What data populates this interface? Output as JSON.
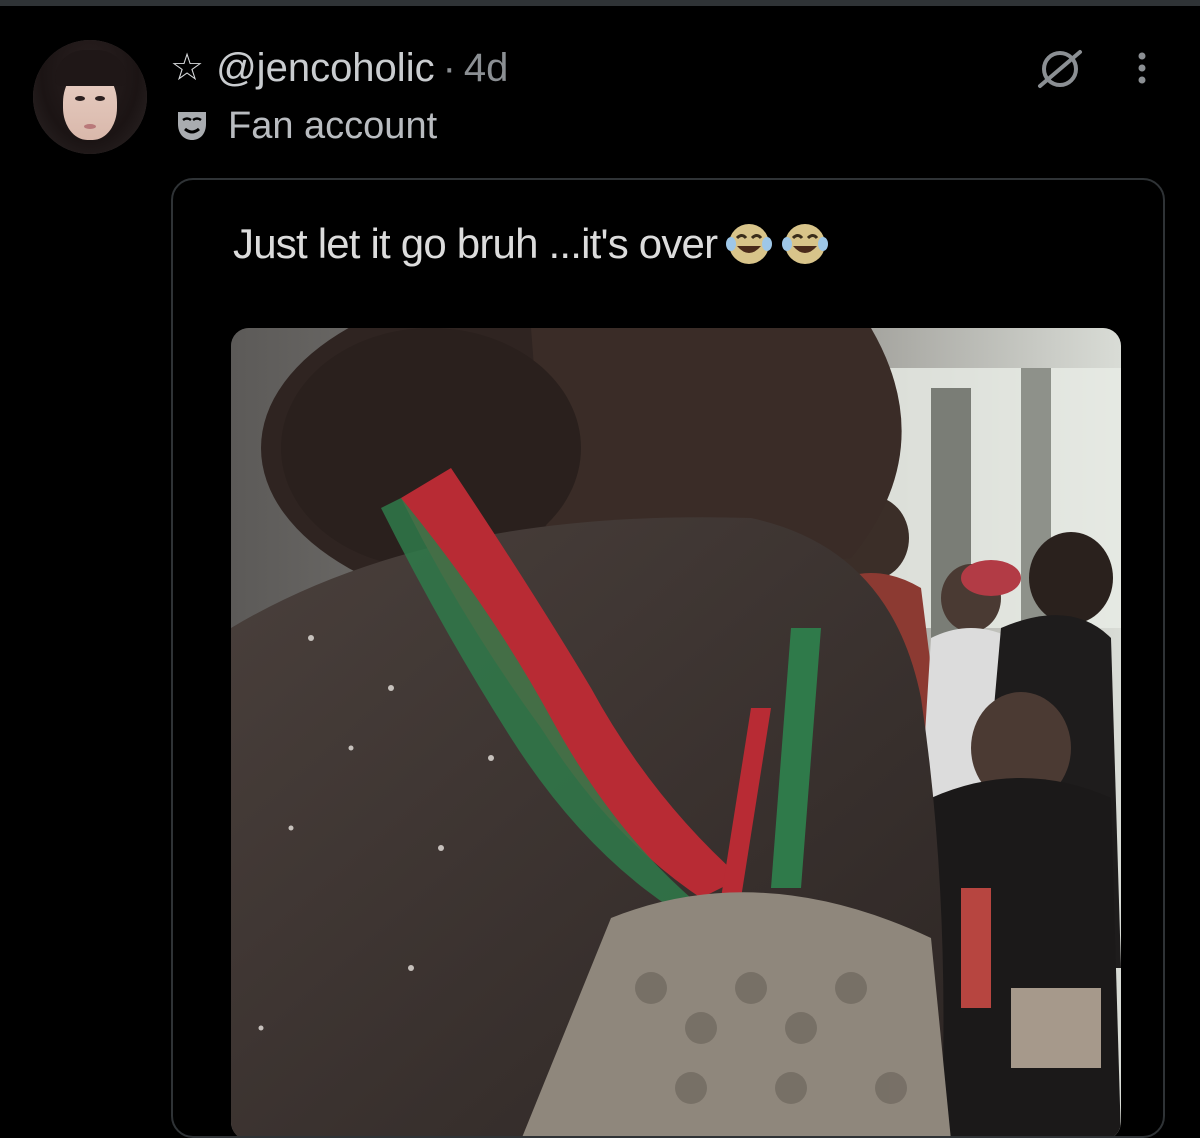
{
  "tweet": {
    "handle": "@jencoholic",
    "separator": "·",
    "time": "4d",
    "label": "Fan account",
    "icons": [
      "star-icon",
      "theater-mask-icon",
      "grok-icon",
      "more-vertical-icon"
    ]
  },
  "quote": {
    "caption": "Just let it go bruh ...it's over",
    "emojis": [
      "laughing-tears-emoji",
      "laughing-tears-emoji"
    ]
  },
  "colors": {
    "background": "#000000",
    "text_secondary": "#b9bcc0",
    "border": "#2f3336"
  }
}
